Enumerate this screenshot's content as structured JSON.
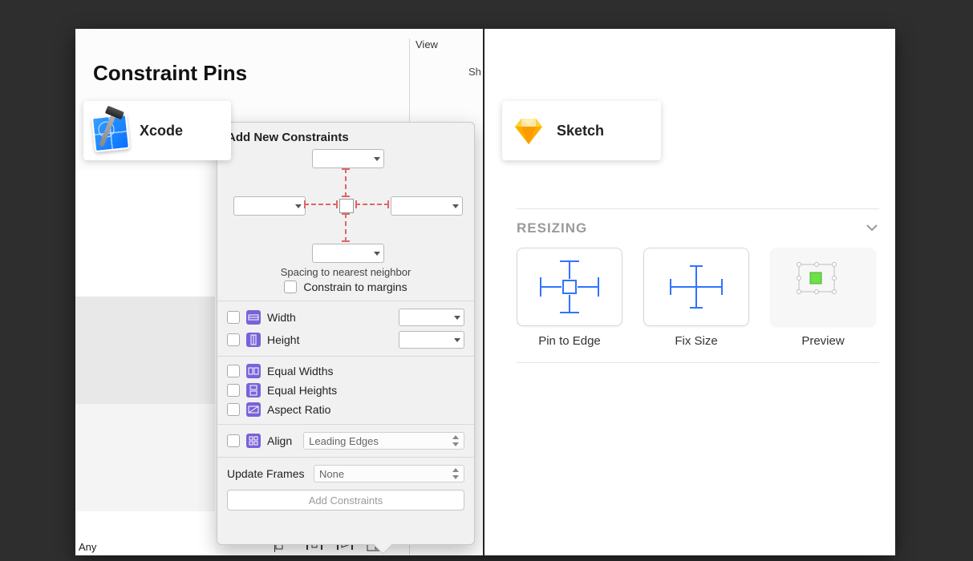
{
  "title": "Constraint Pins",
  "left": {
    "app_label": "Xcode",
    "bg_corner": "Any",
    "ib_right_header": "View",
    "ib_right_partial": "Sh"
  },
  "popover": {
    "title": "Add New Constraints",
    "spacing_label": "Spacing to nearest neighbor",
    "constrain_margins": "Constrain to margins",
    "width_label": "Width",
    "height_label": "Height",
    "equal_widths": "Equal Widths",
    "equal_heights": "Equal Heights",
    "aspect_ratio": "Aspect Ratio",
    "align_label": "Align",
    "align_value": "Leading Edges",
    "update_frames_label": "Update Frames",
    "update_frames_value": "None",
    "add_button": "Add Constraints"
  },
  "right": {
    "app_label": "Sketch",
    "section_title": "RESIZING",
    "cells": [
      {
        "label": "Pin to Edge"
      },
      {
        "label": "Fix Size"
      },
      {
        "label": "Preview"
      }
    ]
  }
}
